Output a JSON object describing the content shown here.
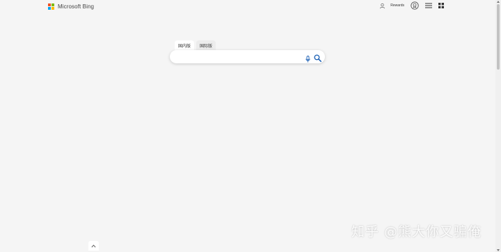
{
  "header": {
    "brand": "Microsoft Bing",
    "rewards_label": "Rewards",
    "logo_colors": [
      "#f25022",
      "#7fba00",
      "#00a4ef",
      "#ffb900"
    ]
  },
  "search": {
    "tabs": [
      {
        "label": "国内版",
        "active": true
      },
      {
        "label": "国际版",
        "active": false
      }
    ],
    "placeholder": "",
    "value": "",
    "accent_color": "#1a5fb4"
  },
  "icons": [
    "user-icon",
    "rewards-medal-icon",
    "hamburger-menu-icon",
    "apps-grid-icon",
    "microphone-icon",
    "search-icon",
    "chevron-up-icon"
  ],
  "watermark": "知乎 @熊大你又骗俺"
}
